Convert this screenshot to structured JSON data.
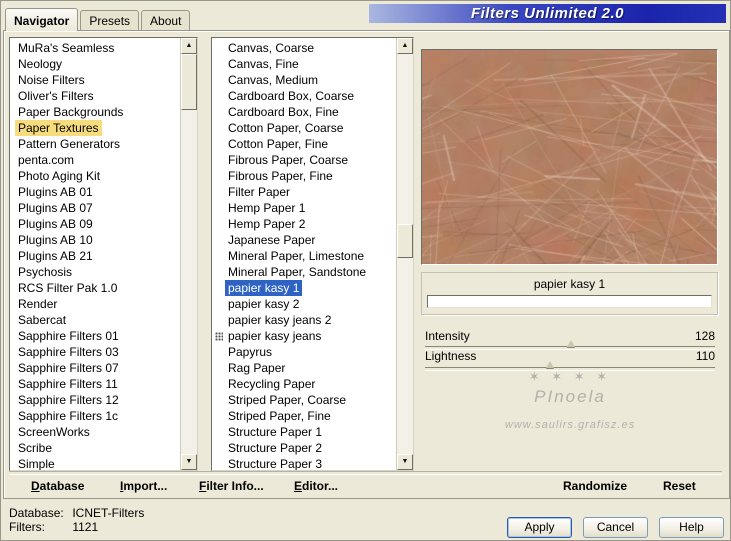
{
  "window": {
    "title": "Filters Unlimited 2.0"
  },
  "tabs": [
    {
      "label": "Navigator",
      "active": true
    },
    {
      "label": "Presets",
      "active": false
    },
    {
      "label": "About",
      "active": false
    }
  ],
  "icons": {
    "scroll_up": "▲",
    "scroll_down": "▼"
  },
  "categories": {
    "selected": "Paper Textures",
    "items": [
      "MuRa's Seamless",
      "Neology",
      "Noise Filters",
      "Oliver's Filters",
      "Paper Backgrounds",
      "Paper Textures",
      "Pattern Generators",
      "penta.com",
      "Photo Aging Kit",
      "Plugins AB 01",
      "Plugins AB 07",
      "Plugins AB 09",
      "Plugins AB 10",
      "Plugins AB 21",
      "Psychosis",
      "RCS Filter Pak 1.0",
      "Render",
      "Sabercat",
      "Sapphire Filters 01",
      "Sapphire Filters 03",
      "Sapphire Filters 07",
      "Sapphire Filters 11",
      "Sapphire Filters 12",
      "Sapphire Filters 1c",
      "ScreenWorks",
      "Scribe",
      "Simple"
    ]
  },
  "filters": {
    "selected": "papier kasy 1",
    "marked": "papier kasy jeans",
    "items": [
      "Canvas, Coarse",
      "Canvas, Fine",
      "Canvas, Medium",
      "Cardboard Box, Coarse",
      "Cardboard Box, Fine",
      "Cotton Paper, Coarse",
      "Cotton Paper, Fine",
      "Fibrous Paper, Coarse",
      "Fibrous Paper, Fine",
      "Filter Paper",
      "Hemp Paper 1",
      "Hemp Paper 2",
      "Japanese Paper",
      "Mineral Paper, Limestone",
      "Mineral Paper, Sandstone",
      "papier kasy 1",
      "papier kasy 2",
      "papier kasy jeans 2",
      "papier kasy jeans",
      "Papyrus",
      "Rag Paper",
      "Recycling Paper",
      "Striped Paper, Coarse",
      "Striped Paper, Fine",
      "Structure Paper 1",
      "Structure Paper 2",
      "Structure Paper 3"
    ]
  },
  "preview": {
    "caption": "papier kasy 1"
  },
  "sliders": [
    {
      "label": "Intensity",
      "value": 128,
      "max": 255
    },
    {
      "label": "Lightness",
      "value": 110,
      "max": 255
    }
  ],
  "watermark": {
    "decoration": "✶ ✶  ✶   ✶",
    "name": "PInoela",
    "site": "www.saulirs.grafisz.es"
  },
  "action_bar": {
    "database": "Database",
    "import": "Import...",
    "filter_info": "Filter Info...",
    "editor": "Editor...",
    "randomize": "Randomize",
    "reset": "Reset"
  },
  "status": {
    "database_label": "Database:",
    "database_value": "ICNET-Filters",
    "filters_label": "Filters:",
    "filters_value": "1121"
  },
  "buttons": {
    "apply": "Apply",
    "cancel": "Cancel",
    "help": "Help"
  },
  "colors": {
    "selection_blue": "#2E63C5",
    "category_highlight": "#F6DC7C",
    "title_blue_dark": "#1B24AC",
    "title_blue_light": "#AAB7E0",
    "dialog_background": "#ECE9D8"
  }
}
